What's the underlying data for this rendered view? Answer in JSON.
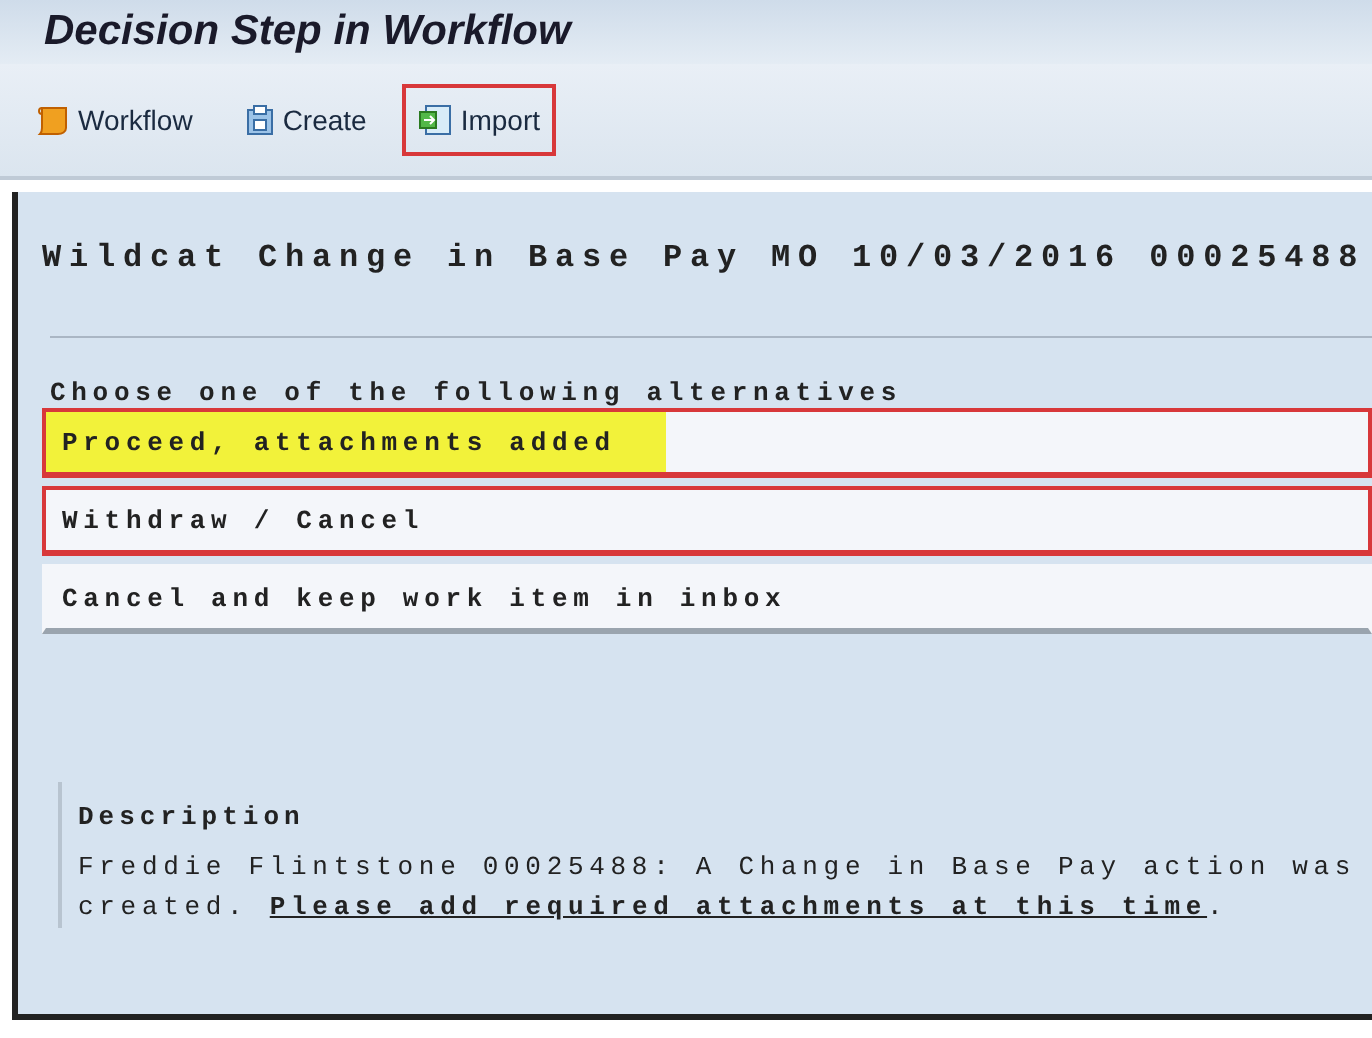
{
  "window": {
    "title": "Decision Step in Workflow"
  },
  "toolbar": [
    {
      "label": "Workflow",
      "kind": "workflow",
      "highlighted": false
    },
    {
      "label": "Create",
      "kind": "create",
      "highlighted": false
    },
    {
      "label": "Import",
      "kind": "import",
      "highlighted": true
    }
  ],
  "heading": "Wildcat Change in Base Pay MO 10/03/2016 00025488",
  "prompt": "Choose one of the following alternatives",
  "alternatives": [
    {
      "label": "Proceed, attachments added",
      "highlighted": true,
      "marked": true
    },
    {
      "label": "Withdraw / Cancel",
      "highlighted": true,
      "marked": false
    },
    {
      "label": "Cancel and keep work item in inbox",
      "highlighted": false,
      "marked": false
    }
  ],
  "description": {
    "title": "Description",
    "text": "Freddie Flintstone 00025488: A Change in Base Pay action was created. ",
    "link": "Please add required attachments at this time",
    "tail": "."
  }
}
